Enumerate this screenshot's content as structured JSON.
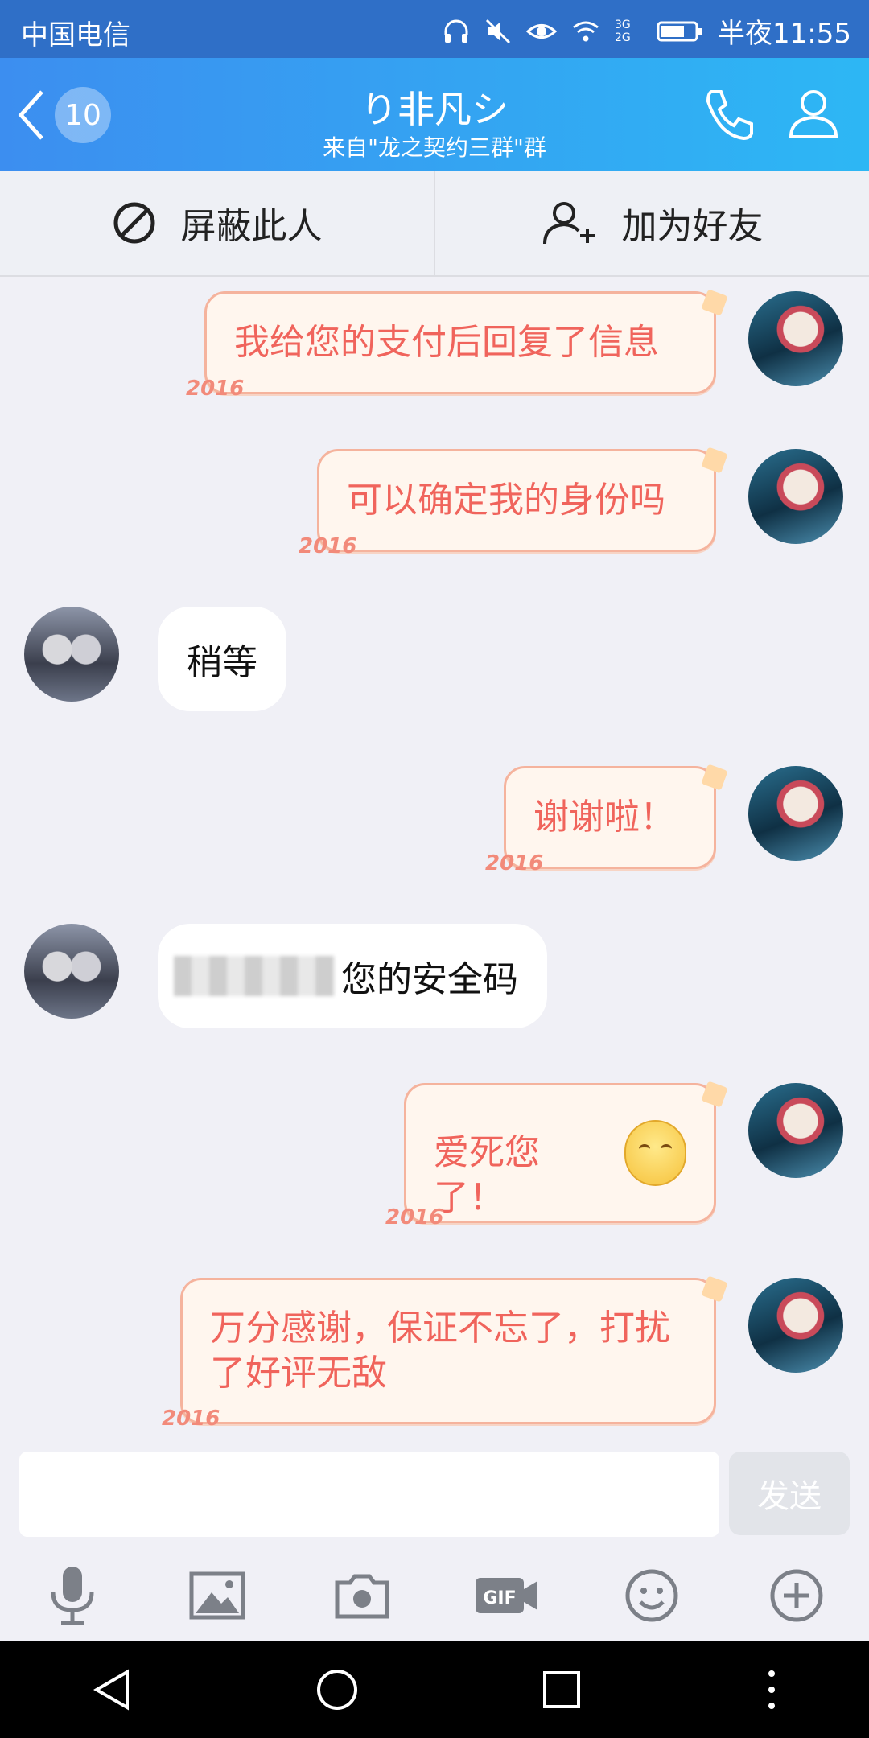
{
  "status": {
    "carrier": "中国电信",
    "time": "半夜11:55",
    "network": "3G 2G"
  },
  "header": {
    "back_count": "10",
    "title": "り非凡シ",
    "subtitle": "来自\"龙之契约三群\"群"
  },
  "actions": {
    "block": "屏蔽此人",
    "add_friend": "加为好友"
  },
  "messages": [
    {
      "from": "me",
      "text": "我给您的支付后回复了信息"
    },
    {
      "from": "me",
      "text": "可以确定我的身份吗"
    },
    {
      "from": "other",
      "text": "稍等"
    },
    {
      "from": "me",
      "text": "谢谢啦！"
    },
    {
      "from": "other",
      "text": "您的安全码"
    },
    {
      "from": "me",
      "text": "爱死您了！"
    },
    {
      "from": "me",
      "text": "万分感谢，保证不忘了，打扰了好评无敌"
    }
  ],
  "bubble_deco": "2016",
  "input": {
    "send": "发送",
    "placeholder": ""
  },
  "toolbar": [
    "microphone-icon",
    "image-icon",
    "camera-icon",
    "gif-icon",
    "emoji-icon",
    "plus-icon"
  ],
  "colors": {
    "header_start": "#3c8ef0",
    "header_end": "#2db7f4",
    "my_text": "#f0645c"
  }
}
